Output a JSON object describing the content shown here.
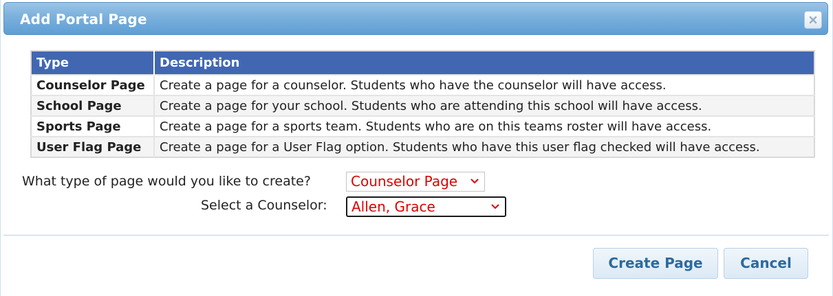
{
  "dialog": {
    "title": "Add Portal Page",
    "close_icon": "close-x-icon"
  },
  "table": {
    "headers": [
      "Type",
      "Description"
    ],
    "rows": [
      {
        "type": "Counselor Page",
        "description": "Create a page for a counselor. Students who have the counselor will have access."
      },
      {
        "type": "School Page",
        "description": "Create a page for your school. Students who are attending this school will have access."
      },
      {
        "type": "Sports Page",
        "description": "Create a page for a sports team. Students who are on this teams roster will have access."
      },
      {
        "type": "User Flag Page",
        "description": "Create a page for a User Flag option. Students who have this user flag checked will have access."
      }
    ]
  },
  "form": {
    "page_type_label": "What type of page would you like to create?",
    "page_type_value": "Counselor Page",
    "counselor_label": "Select a Counselor:",
    "counselor_value": "Allen, Grace"
  },
  "buttons": {
    "create": "Create Page",
    "cancel": "Cancel"
  },
  "colors": {
    "header_bg": "#4267b2",
    "select_text": "#e00000",
    "button_text": "#2c6a9e"
  }
}
